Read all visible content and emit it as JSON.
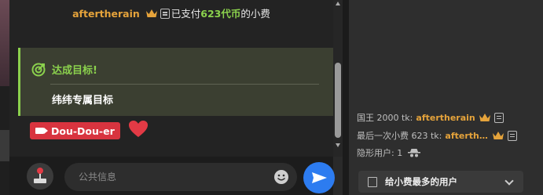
{
  "chat": {
    "tip_message": {
      "username": "aftertherain",
      "text_before": "已支付",
      "amount": "623代币",
      "text_after": "的小费"
    },
    "goal": {
      "title": "达成目标!",
      "name": "纬纬专属目标"
    },
    "user_tag": "Dou-Dou-er",
    "input": {
      "placeholder": "公共信息"
    }
  },
  "sidebar": {
    "king": {
      "label": "国王 2000 tk:",
      "username": "aftertherain"
    },
    "last_tip": {
      "label": "最后一次小费 623 tk:",
      "username": "aftertherain"
    },
    "hidden_users": {
      "label": "隐形用户: 1"
    },
    "top_tippers_button": "给小费最多的用户"
  },
  "colors": {
    "accent_green": "#8bd14d",
    "username_gold": "#e5a33b",
    "tag_red": "#d8343f",
    "send_blue": "#2d7cf0"
  }
}
